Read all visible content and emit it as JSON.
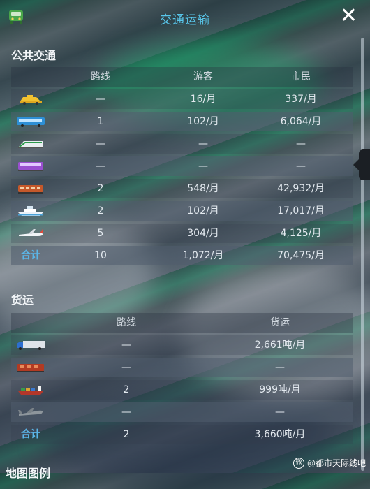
{
  "window": {
    "title": "交通运输",
    "close_glyph": "✕"
  },
  "public_transport": {
    "title": "公共交通",
    "headers": {
      "routes": "路线",
      "tourists": "游客",
      "citizens": "市民"
    },
    "rows": [
      {
        "icon": "taxi-icon",
        "routes": "—",
        "tourists": "16/月",
        "citizens": "337/月"
      },
      {
        "icon": "bus-icon",
        "routes": "1",
        "tourists": "102/月",
        "citizens": "6,064/月"
      },
      {
        "icon": "tram-icon",
        "routes": "—",
        "tourists": "—",
        "citizens": "—"
      },
      {
        "icon": "metro-icon",
        "routes": "—",
        "tourists": "—",
        "citizens": "—"
      },
      {
        "icon": "train-icon",
        "routes": "2",
        "tourists": "548/月",
        "citizens": "42,932/月"
      },
      {
        "icon": "ship-icon",
        "routes": "2",
        "tourists": "102/月",
        "citizens": "17,017/月"
      },
      {
        "icon": "airplane-icon",
        "routes": "5",
        "tourists": "304/月",
        "citizens": "4,125/月"
      }
    ],
    "total": {
      "label": "合计",
      "routes": "10",
      "tourists": "1,072/月",
      "citizens": "70,475/月"
    }
  },
  "freight": {
    "title": "货运",
    "headers": {
      "routes": "路线",
      "cargo": "货运"
    },
    "rows": [
      {
        "icon": "truck-icon",
        "routes": "—",
        "cargo": "2,661吨/月"
      },
      {
        "icon": "cargo-train-icon",
        "routes": "—",
        "cargo": "—"
      },
      {
        "icon": "cargo-ship-icon",
        "routes": "2",
        "cargo": "999吨/月"
      },
      {
        "icon": "cargo-plane-icon",
        "routes": "—",
        "cargo": "—"
      }
    ],
    "total": {
      "label": "合计",
      "routes": "2",
      "cargo": "3,660吨/月"
    }
  },
  "legend_title": "地图图例",
  "watermark": "@都市天际线吧"
}
